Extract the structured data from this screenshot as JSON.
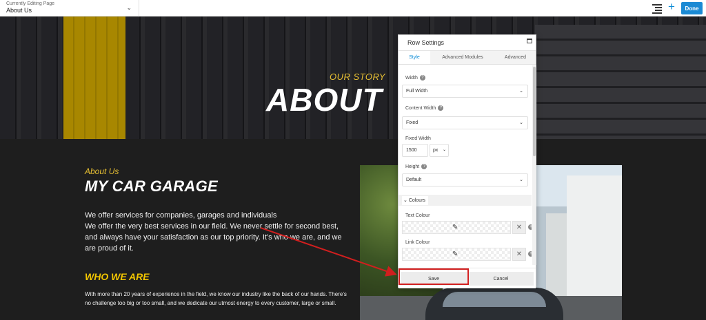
{
  "topbar": {
    "editing_label": "Currently Editing Page",
    "page_name": "About Us",
    "done_label": "Done",
    "icons": [
      "outline-icon",
      "plus-icon",
      "chevron-down-icon"
    ]
  },
  "hero": {
    "kicker": "OUR STORY",
    "title": "ABOUT"
  },
  "content": {
    "about_us": "About Us",
    "heading": "MY CAR GARAGE",
    "para1_line1": "We offer services for companies, garages and individuals",
    "para1_line2": "We offer the very best services in our field. We never settle for second best, and always have your satisfaction as our top priority. It’s who we are, and we are proud of it.",
    "who_heading": "WHO WE ARE",
    "para2": "With more than 20 years of experience in the field, we know our industry like the back of our hands. There’s no challenge too big or too small, and we dedicate our utmost energy to every customer, large or small."
  },
  "panel": {
    "title": "Row Settings",
    "tabs": [
      {
        "label": "Style",
        "active": true
      },
      {
        "label": "Advanced Modules",
        "active": false
      },
      {
        "label": "Advanced",
        "active": false
      }
    ],
    "width_label": "Width",
    "width_value": "Full Width",
    "content_width_label": "Content Width",
    "content_width_value": "Fixed",
    "fixed_width_label": "Fixed Width",
    "fixed_width_value": "1500",
    "fixed_width_unit": "px",
    "height_label": "Height",
    "height_value": "Default",
    "colours_section": "Colours",
    "text_colour_label": "Text Colour",
    "link_colour_label": "Link Colour",
    "save_label": "Save",
    "cancel_label": "Cancel"
  },
  "colors": {
    "accent_blue": "#1a8ad4",
    "brand_yellow": "#e8c033",
    "annotation_red": "#d11e1e"
  }
}
